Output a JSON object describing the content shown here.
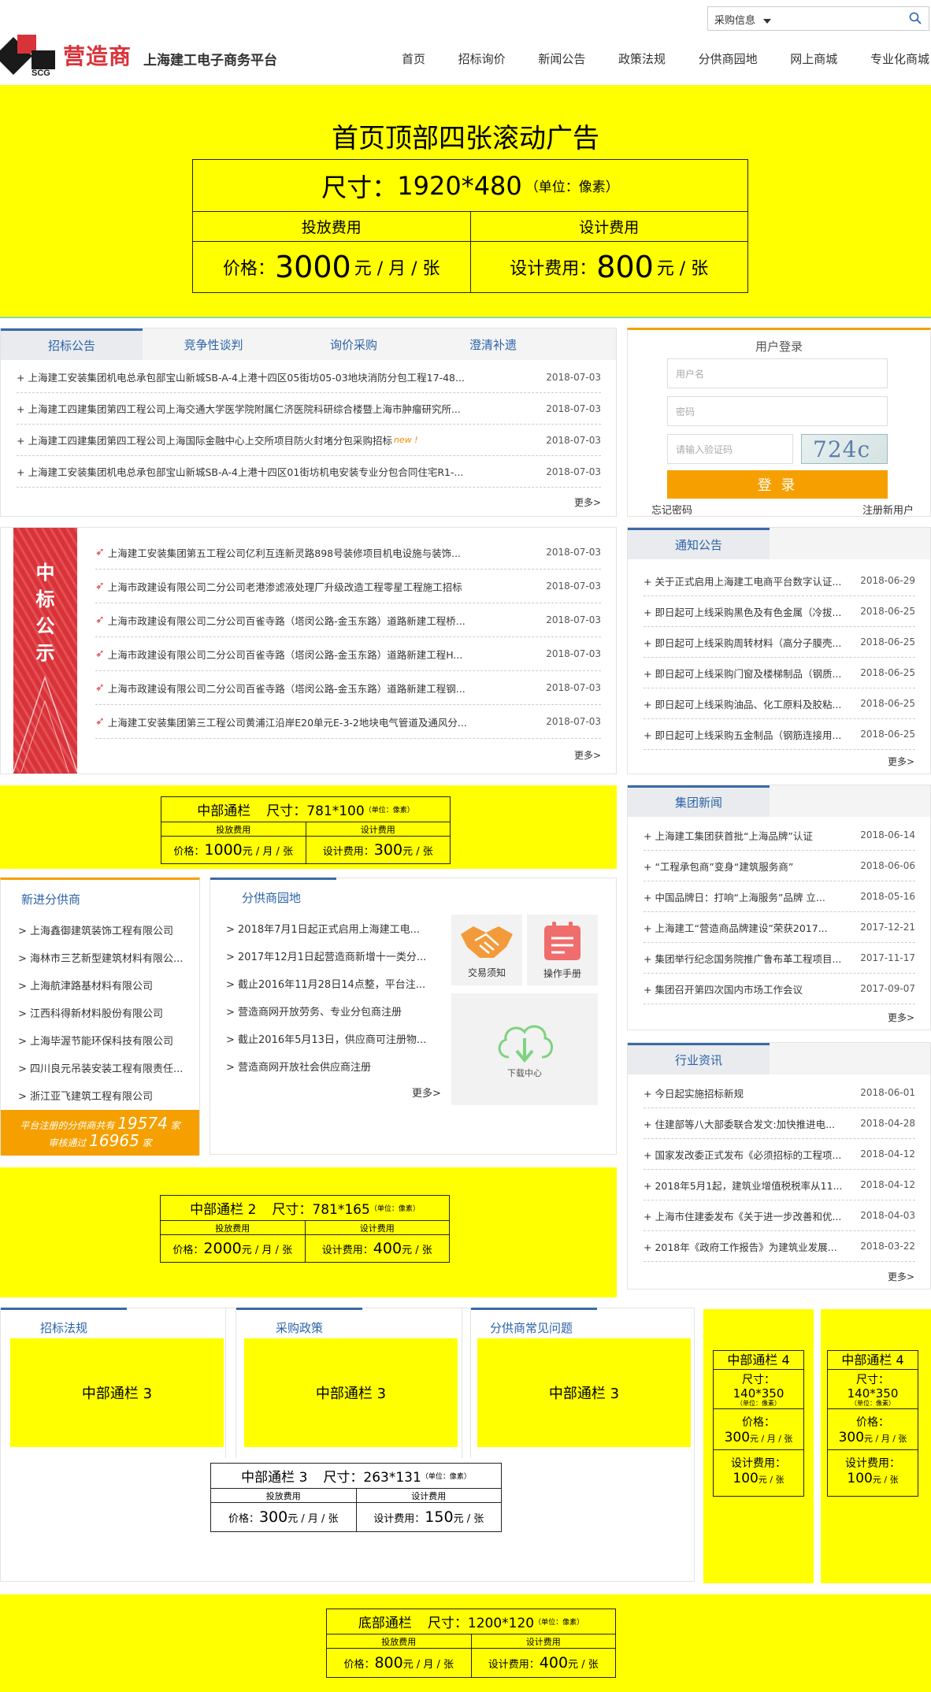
{
  "header": {
    "search_select": "采购信息",
    "logo_brand": "营造商",
    "logo_sub": "上海建工电子商务平台",
    "nav": [
      "首页",
      "招标询价",
      "新闻公告",
      "政策法规",
      "分供商园地",
      "网上商城",
      "专业化商城"
    ]
  },
  "banner": {
    "title": "首页顶部四张滚动广告",
    "size_label": "尺寸：",
    "size_value": "1920*480",
    "size_unit": "（单位：像素）",
    "col1": "投放费用",
    "col2": "设计费用",
    "price_label": "价格：",
    "price_value": "3000",
    "price_unit": "元 / 月 / 张",
    "design_label": "设计费用：",
    "design_value": "800",
    "design_unit": "元 / 张"
  },
  "bidding": {
    "tabs": [
      "招标公告",
      "竞争性谈判",
      "询价采购",
      "澄清补遗"
    ],
    "items": [
      {
        "t": "+ 上海建工安装集团机电总承包部宝山新城SB-A-4上港十四区05街坊05-03地块消防分包工程17-48...",
        "d": "2018-07-03"
      },
      {
        "t": "+ 上海建工四建集团第四工程公司上海交通大学医学院附属仁济医院科研综合楼暨上海市肿瘤研究所...",
        "d": "2018-07-03"
      },
      {
        "t": "+ 上海建工四建集团第四工程公司上海国际金融中心上交所项目防火封堵分包采购招标",
        "d": "2018-07-03",
        "new": "new !"
      },
      {
        "t": "+ 上海建工安装集团机电总承包部宝山新城SB-A-4上港十四区01街坊机电安装专业分包合同住宅R1-...",
        "d": "2018-07-03"
      }
    ],
    "more": "更多>"
  },
  "login": {
    "title": "用户登录",
    "username_ph": "用户名",
    "password_ph": "密码",
    "captcha_ph": "请输入验证码",
    "captcha": "724c",
    "submit": "登 录",
    "forgot": "忘记密码",
    "register": "注册新用户"
  },
  "winning": {
    "side_chars": [
      "中",
      "标",
      "公",
      "示"
    ],
    "items": [
      {
        "t": "上海建工安装集团第五工程公司亿利互连新灵路898号装修项目机电设施与装饰...",
        "d": "2018-07-03"
      },
      {
        "t": "上海市政建设有限公司二分公司老港渗滤液处理厂升级改造工程零星工程施工招标",
        "d": "2018-07-03"
      },
      {
        "t": "上海市政建设有限公司二分公司百雀寺路（塔闵公路-金玉东路）道路新建工程桥...",
        "d": "2018-07-03"
      },
      {
        "t": "上海市政建设有限公司二分公司百雀寺路（塔闵公路-金玉东路）道路新建工程H...",
        "d": "2018-07-03"
      },
      {
        "t": "上海市政建设有限公司二分公司百雀寺路（塔闵公路-金玉东路）道路新建工程钢...",
        "d": "2018-07-03"
      },
      {
        "t": "上海建工安装集团第三工程公司黄浦江沿岸E20单元E-3-2地块电气管道及通风分...",
        "d": "2018-07-03"
      }
    ],
    "more": "更多>"
  },
  "notice": {
    "title": "通知公告",
    "items": [
      {
        "t": "+ 关于正式启用上海建工电商平台数字认证...",
        "d": "2018-06-29"
      },
      {
        "t": "+ 即日起可上线采购黑色及有色金属（冷拔...",
        "d": "2018-06-25"
      },
      {
        "t": "+ 即日起可上线采购周转材料（高分子膜壳...",
        "d": "2018-06-25"
      },
      {
        "t": "+ 即日起可上线采购门窗及楼梯制品（钢质...",
        "d": "2018-06-25"
      },
      {
        "t": "+ 即日起可上线采购油品、化工原料及胶粘...",
        "d": "2018-06-25"
      },
      {
        "t": "+ 即日起可上线采购五金制品（钢筋连接用...",
        "d": "2018-06-25"
      }
    ],
    "more": "更多>"
  },
  "ad_mid1": {
    "title": "中部通栏",
    "size": "尺寸：781*100",
    "unit": "（单位：像素）",
    "c1": "投放费用",
    "c2": "设计费用",
    "pl": "价格：",
    "pv": "1000",
    "pu": "元 / 月 / 张",
    "dl": "设计费用：",
    "dv": "300",
    "du": "元 / 张"
  },
  "group_news": {
    "title": "集团新闻",
    "items": [
      {
        "t": "+ 上海建工集团获首批“上海品牌”认证",
        "d": "2018-06-14"
      },
      {
        "t": "+ “工程承包商”变身“建筑服务商”",
        "d": "2018-06-06"
      },
      {
        "t": "+ 中国品牌日：打响“上海服务”品牌 立...",
        "d": "2018-05-16"
      },
      {
        "t": "+ 上海建工“营造商品牌建设”荣获2017...",
        "d": "2017-12-21"
      },
      {
        "t": "+ 集团举行纪念国务院推广鲁布革工程项目...",
        "d": "2017-11-17"
      },
      {
        "t": "+ 集团召开第四次国内市场工作会议",
        "d": "2017-09-07"
      }
    ],
    "more": "更多>"
  },
  "new_suppliers": {
    "title": "新进分供商",
    "items": [
      "> 上海鑫御建筑装饰工程有限公司",
      "> 海林市三艺新型建筑材料有限公...",
      "> 上海航津路基材料有限公司",
      "> 江西科得新材料股份有限公司",
      "> 上海毕渥节能环保科技有限公司",
      "> 四川良元吊装安装工程有限责任...",
      "> 浙江亚飞建筑工程有限公司"
    ],
    "stat1_pre": "平台注册的分供商共有",
    "stat1_num": "19574",
    "stat1_suf": "家",
    "stat2_pre": "审核通过",
    "stat2_num": "16965",
    "stat2_suf": "家"
  },
  "supplier_garden": {
    "title": "分供商园地",
    "items": [
      "> 2018年7月1日起正式启用上海建工电...",
      "> 2017年12月1日起营造商新增十一类分...",
      "> 截止2016年11月28日14点整，平台注...",
      "> 营造商网开放劳务、专业分包商注册",
      "> 截止2016年5月13日，供应商可注册物...",
      "> 营造商网开放社会供应商注册"
    ],
    "more": "更多>",
    "tiles": [
      "交易须知",
      "操作手册",
      "下载中心"
    ]
  },
  "industry": {
    "title": "行业资讯",
    "items": [
      {
        "t": "+ 今日起实施招标新规",
        "d": "2018-06-01"
      },
      {
        "t": "+ 住建部等八大部委联合发文:加快推进电...",
        "d": "2018-04-28"
      },
      {
        "t": "+ 国家发改委正式发布《必须招标的工程项...",
        "d": "2018-04-12"
      },
      {
        "t": "+ 2018年5月1起，建筑业增值税税率从11...",
        "d": "2018-04-12"
      },
      {
        "t": "+ 上海市住建委发布《关于进一步改善和优...",
        "d": "2018-04-03"
      },
      {
        "t": "+ 2018年《政府工作报告》为建筑业发展...",
        "d": "2018-03-22"
      }
    ],
    "more": "更多>"
  },
  "ad_mid2": {
    "title": "中部通栏 2",
    "size": "尺寸：781*165",
    "unit": "（单位：像素）",
    "c1": "投放费用",
    "c2": "设计费用",
    "pl": "价格：",
    "pv": "2000",
    "pu": "元 / 月 / 张",
    "dl": "设计费用：",
    "dv": "400",
    "du": "元 / 张"
  },
  "policy": {
    "tabs": [
      "招标法规",
      "采购政策",
      "分供商常见问题"
    ],
    "ad_label": "中部通栏 3"
  },
  "ad_mid3": {
    "title": "中部通栏 3",
    "size": "尺寸：263*131",
    "unit": "（单位：像素）",
    "c1": "投放费用",
    "c2": "设计费用",
    "pl": "价格：",
    "pv": "300",
    "pu": "元 / 月 / 张",
    "dl": "设计费用：",
    "dv": "150",
    "du": "元 / 张"
  },
  "ad_side": {
    "title": "中部通栏 4",
    "size_l": "尺寸：",
    "size_v": "140*350",
    "unit": "（单位：像素）",
    "pl": "价格：",
    "pv": "300",
    "pu": "元 / 月 / 张",
    "dl": "设计费用：",
    "dv": "100",
    "du": "元 / 张"
  },
  "ad_bottom": {
    "title": "底部通栏",
    "size": "尺寸：1200*120",
    "unit": "（单位：像素）",
    "c1": "投放费用",
    "c2": "设计费用",
    "pl": "价格：",
    "pv": "800",
    "pu": "元 / 月 / 张",
    "dl": "设计费用：",
    "dv": "400",
    "du": "元 / 张"
  },
  "colors": {
    "accent": "#2c63a8",
    "orange": "#f5a000",
    "ad": "#ffff00",
    "red": "#d9333a"
  }
}
